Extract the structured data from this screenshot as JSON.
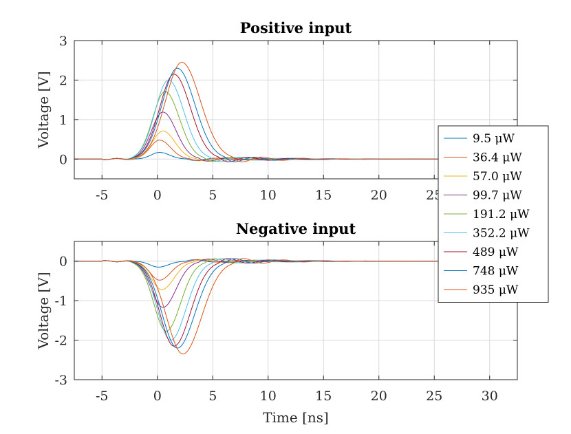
{
  "chart_data": {
    "type": "line",
    "xlabel": "Time [ns]",
    "xlim": [
      -7.5,
      32.5
    ],
    "xticks": [
      -5,
      0,
      5,
      10,
      15,
      20,
      25,
      30
    ],
    "series_colors": [
      "#0072BD",
      "#D95319",
      "#EDB120",
      "#7E2F8E",
      "#77AC30",
      "#4DBEEE",
      "#A2142F",
      "#0072BD",
      "#D95319"
    ],
    "legend": {
      "placement": "right",
      "entries": [
        "9.5 μW",
        "36.4 μW",
        "57.0 μW",
        "99.7 μW",
        "191.2 μW",
        "352.2 μW",
        "489 μW",
        "748 μW",
        "935 μW"
      ]
    },
    "panels": [
      {
        "title": "Positive input",
        "ylabel": "Voltage [V]",
        "ylim": [
          -0.5,
          3
        ],
        "yticks": [
          0,
          1,
          2,
          3
        ],
        "grid": true,
        "series": [
          {
            "name": "9.5 μW",
            "peak_time": 0.2,
            "peak": 0.17
          },
          {
            "name": "36.4 μW",
            "peak_time": 0.2,
            "peak": 0.48
          },
          {
            "name": "57.0 μW",
            "peak_time": 0.5,
            "peak": 0.71
          },
          {
            "name": "99.7 μW",
            "peak_time": 0.5,
            "peak": 1.19
          },
          {
            "name": "191.2 μW",
            "peak_time": 0.7,
            "peak": 1.71
          },
          {
            "name": "352.2 μW",
            "peak_time": 1.0,
            "peak": 2.0
          },
          {
            "name": "489 μW",
            "peak_time": 1.5,
            "peak": 2.15
          },
          {
            "name": "748 μW",
            "peak_time": 1.8,
            "peak": 2.3
          },
          {
            "name": "935 μW",
            "peak_time": 2.2,
            "peak": 2.45
          }
        ]
      },
      {
        "title": "Negative input",
        "ylabel": "Voltage [V]",
        "ylim": [
          -3,
          0.5
        ],
        "yticks": [
          -3,
          -2,
          -1,
          0
        ],
        "grid": true,
        "series": [
          {
            "name": "9.5 μW",
            "peak_time": 0.1,
            "peak": -0.15
          },
          {
            "name": "36.4 μW",
            "peak_time": 0.2,
            "peak": -0.48
          },
          {
            "name": "57.0 μW",
            "peak_time": 0.4,
            "peak": -0.72
          },
          {
            "name": "99.7 μW",
            "peak_time": 0.5,
            "peak": -1.17
          },
          {
            "name": "191.2 μW",
            "peak_time": 0.8,
            "peak": -1.77
          },
          {
            "name": "352.2 μW",
            "peak_time": 1.2,
            "peak": -2.0
          },
          {
            "name": "489 μW",
            "peak_time": 1.5,
            "peak": -2.15
          },
          {
            "name": "748 μW",
            "peak_time": 1.8,
            "peak": -2.2
          },
          {
            "name": "935 μW",
            "peak_time": 2.3,
            "peak": -2.35
          }
        ]
      }
    ]
  }
}
